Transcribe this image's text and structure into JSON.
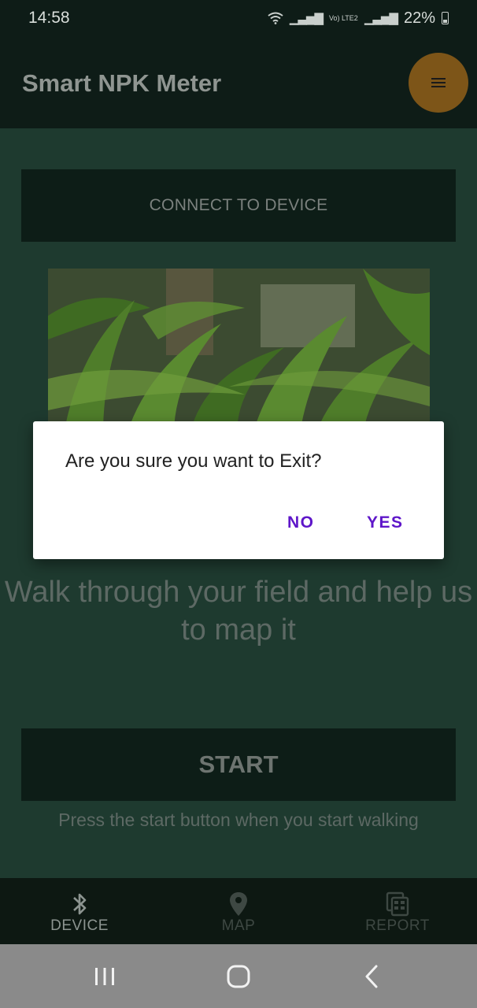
{
  "status_bar": {
    "time": "14:58",
    "battery": "22%",
    "network": "Vo) LTE2"
  },
  "app_bar": {
    "title": "Smart NPK Meter",
    "menu_icon": "menu-icon"
  },
  "main": {
    "connect_label": "CONNECT TO DEVICE",
    "prompt": "Walk through your field and help us to map it",
    "start_label": "START",
    "hint": "Press the start button when you start walking"
  },
  "dialog": {
    "message": "Are you sure you want to Exit?",
    "no_label": "NO",
    "yes_label": "YES",
    "accent": "#5e16c9"
  },
  "bottom_nav": {
    "items": [
      {
        "label": "DEVICE",
        "icon": "bluetooth-icon",
        "active": true
      },
      {
        "label": "MAP",
        "icon": "map-pin-icon",
        "active": false
      },
      {
        "label": "REPORT",
        "icon": "report-icon",
        "active": false
      }
    ]
  },
  "colors": {
    "app_bar": "#0e1c17",
    "main_bg": "#1e3a2f",
    "fab": "#7d5518",
    "nav_bar": "#8a8a8a"
  }
}
